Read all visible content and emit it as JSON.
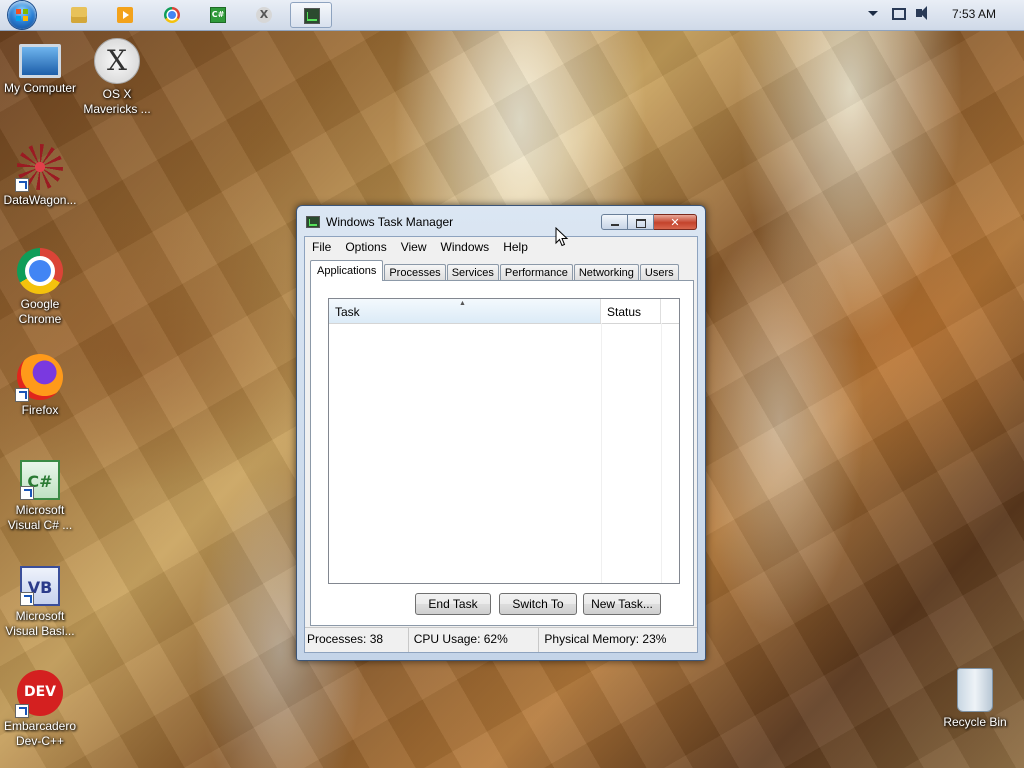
{
  "taskbar": {
    "start_button": "Start",
    "pinned": [
      {
        "icon": "folder-icon"
      },
      {
        "icon": "media-player-icon"
      },
      {
        "icon": "chrome-icon"
      },
      {
        "icon": "visual-csharp-icon"
      },
      {
        "icon": "osx-installer-icon"
      },
      {
        "icon": "task-manager-icon",
        "active": true
      }
    ],
    "tray": {
      "clock": "7:53 AM"
    }
  },
  "desktop": {
    "icons": [
      {
        "label": "My Computer",
        "icon": "computer-icon"
      },
      {
        "label": "OS X\nMavericks ...",
        "icon": "osx-mavericks-icon"
      },
      {
        "label": "DataWagon...",
        "icon": "datawagon-icon"
      },
      {
        "label": "Google\nChrome",
        "icon": "chrome-icon"
      },
      {
        "label": "Firefox",
        "icon": "firefox-icon"
      },
      {
        "label": "Microsoft\nVisual C# ...",
        "icon": "visual-csharp-icon"
      },
      {
        "label": "Microsoft\nVisual Basi...",
        "icon": "visual-basic-icon"
      },
      {
        "label": "Embarcadero\nDev-C++",
        "icon": "dev-cpp-icon"
      },
      {
        "label": "Recycle Bin",
        "icon": "recycle-bin-icon"
      }
    ]
  },
  "window": {
    "title": "Windows Task Manager",
    "menu": [
      "File",
      "Options",
      "View",
      "Windows",
      "Help"
    ],
    "tabs": [
      "Applications",
      "Processes",
      "Services",
      "Performance",
      "Networking",
      "Users"
    ],
    "selected_tab": "Applications",
    "list": {
      "columns": [
        "Task",
        "Status"
      ],
      "rows": []
    },
    "buttons": {
      "end_task": "End Task",
      "switch_to": "Switch To",
      "new_task": "New Task..."
    },
    "status": {
      "processes": "Processes: 38",
      "cpu": "CPU Usage: 62%",
      "memory": "Physical Memory: 23%"
    }
  }
}
